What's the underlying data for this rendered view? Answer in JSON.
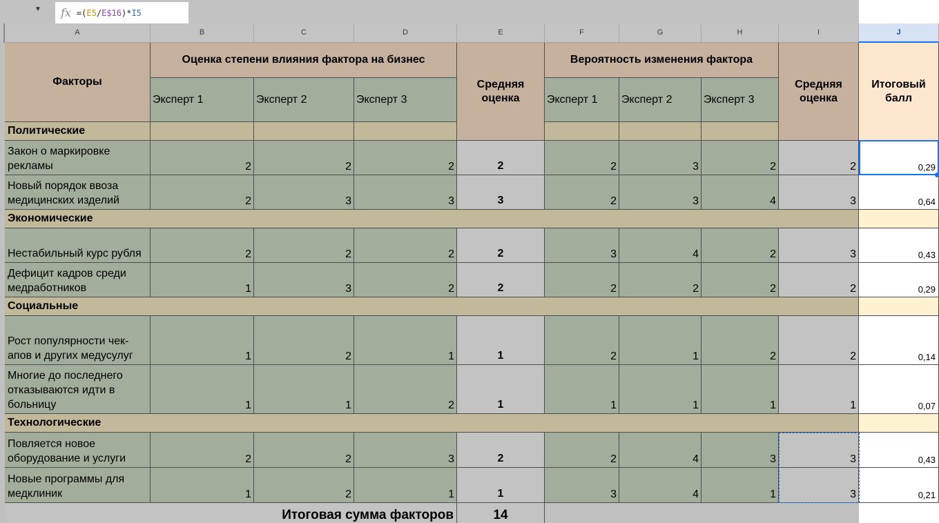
{
  "formula_bar": {
    "icon": "fx-icon",
    "formula_prefix": "=(",
    "ref1": "E5",
    "div": "/",
    "ref2": "E$16",
    "mid": ")*",
    "ref3": "I5"
  },
  "columns": [
    "A",
    "B",
    "C",
    "D",
    "E",
    "F",
    "G",
    "H",
    "I",
    "J"
  ],
  "headers": {
    "factors": "Факторы",
    "impact_group": "Оценка степени влияния фактора на бизнес",
    "prob_group": "Вероятность изменения фактора",
    "expert1": "Эксперт 1",
    "expert2": "Эксперт 2",
    "expert3": "Эксперт 3",
    "avg": "Средняя оценка",
    "total": "Итоговый балл"
  },
  "categories": [
    "Политические",
    "Экономические",
    "Социальные",
    "Технологические"
  ],
  "rows": [
    {
      "name": "Закон о маркировке рекламы",
      "b": "2",
      "c": "2",
      "d": "2",
      "e": "2",
      "f": "2",
      "g": "3",
      "h": "2",
      "i": "2",
      "j": "0,29"
    },
    {
      "name": "Новый порядок ввоза медицинских изделий",
      "b": "2",
      "c": "3",
      "d": "3",
      "e": "3",
      "f": "2",
      "g": "3",
      "h": "4",
      "i": "3",
      "j": "0,64"
    },
    {
      "name": "Нестабильный курс рубля",
      "b": "2",
      "c": "2",
      "d": "2",
      "e": "2",
      "f": "3",
      "g": "4",
      "h": "2",
      "i": "3",
      "j": "0,43"
    },
    {
      "name": "Дефицит кадров среди медработников",
      "b": "1",
      "c": "3",
      "d": "2",
      "e": "2",
      "f": "2",
      "g": "2",
      "h": "2",
      "i": "2",
      "j": "0,29"
    },
    {
      "name": "Рост популярности чек-апов и других медусулуг",
      "b": "1",
      "c": "2",
      "d": "1",
      "e": "1",
      "f": "2",
      "g": "1",
      "h": "2",
      "i": "2",
      "j": "0,14"
    },
    {
      "name": "Многие до последнего отказываются идти в больницу",
      "b": "1",
      "c": "1",
      "d": "2",
      "e": "1",
      "f": "1",
      "g": "1",
      "h": "1",
      "i": "1",
      "j": "0,07"
    },
    {
      "name": "Повляется новое оборудование и услуги",
      "b": "2",
      "c": "2",
      "d": "3",
      "e": "2",
      "f": "2",
      "g": "4",
      "h": "3",
      "i": "3",
      "j": "0,43"
    },
    {
      "name": "Новые программы для медклиник",
      "b": "1",
      "c": "2",
      "d": "1",
      "e": "1",
      "f": "3",
      "g": "4",
      "h": "1",
      "i": "3",
      "j": "0,21"
    }
  ],
  "footer": {
    "label": "Итоговая сумма факторов",
    "value": "14"
  },
  "colors": {
    "header_brown": "#c6b19f",
    "expert_green": "#a3ad9b",
    "category_tan": "#c2b99a",
    "average_gray": "#c3c3c3",
    "total_header": "#fce6cd",
    "selection_blue": "#1a73e8"
  }
}
